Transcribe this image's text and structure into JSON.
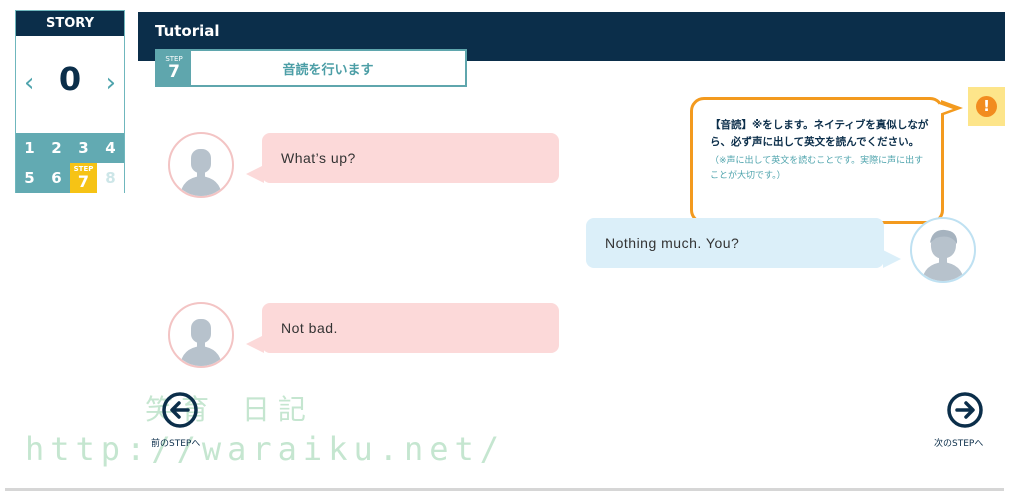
{
  "story": {
    "title": "STORY",
    "prev": "‹",
    "next": "›",
    "current": "0",
    "steps_row1": [
      "1",
      "2",
      "3",
      "4"
    ],
    "steps_row2_done": [
      "5",
      "6"
    ],
    "active_step": {
      "mini": "STEP",
      "num": "7"
    },
    "future_step": "8"
  },
  "header": {
    "title": "Tutorial",
    "step_mini": "STEP",
    "step_num": "7",
    "step_text": "音読を行います"
  },
  "tip": {
    "icon": "!",
    "main": "【音読】※をします。ネイティブを真似しながら、必ず声に出して英文を読んでください。",
    "note": "（※声に出して英文を読むことです。実際に声に出すことが大切です。）"
  },
  "dialogue": [
    {
      "speaker": "left",
      "text": "What’s up?"
    },
    {
      "speaker": "right",
      "text": "Nothing  much.  You?"
    },
    {
      "speaker": "left",
      "text": "Not  bad."
    }
  ],
  "nav": {
    "prev_label": "前のSTEPへ",
    "next_label": "次のSTEPへ"
  },
  "watermark": {
    "line1": "笑育 日記",
    "line2": "http://waraiku.net/"
  },
  "colors": {
    "navy": "#0b2e4a",
    "teal": "#5fa6ad",
    "yellow": "#f6c315",
    "orange": "#f39a1e",
    "pink_bubble": "#fcd9d9",
    "blue_bubble": "#dbeff9"
  }
}
